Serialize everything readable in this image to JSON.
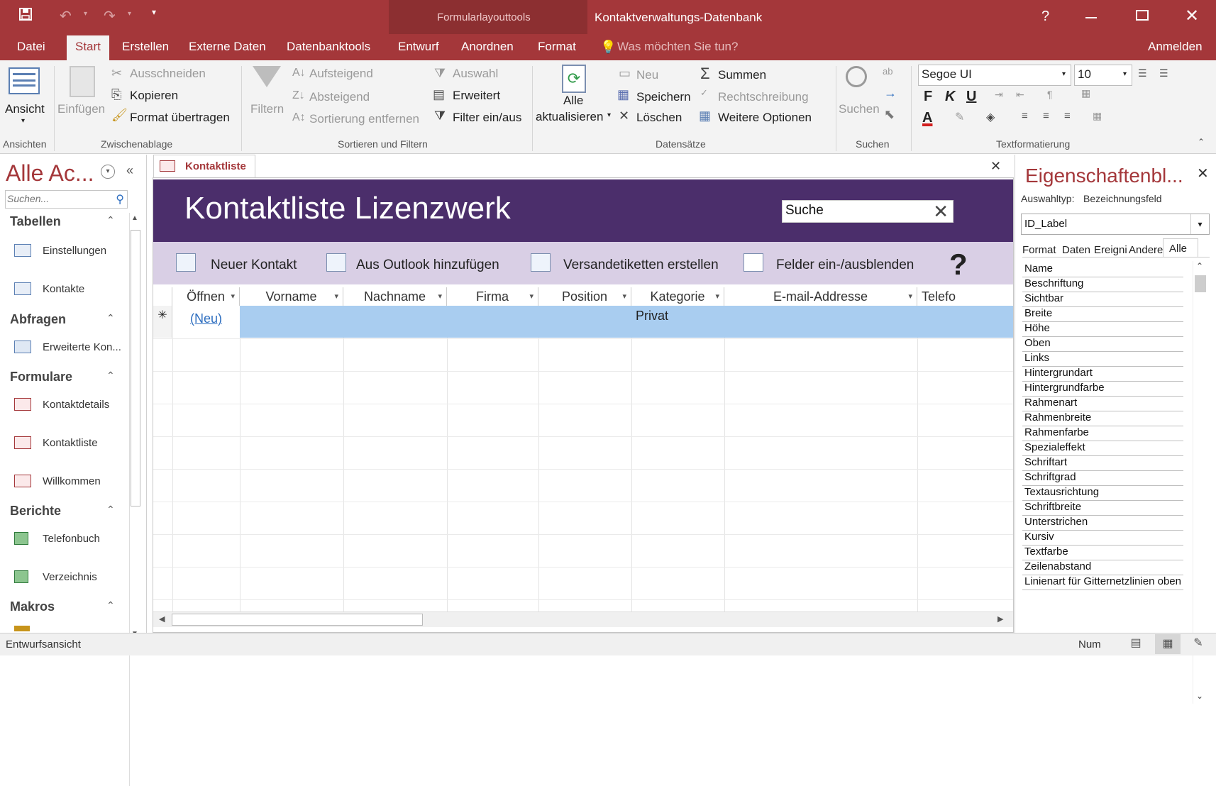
{
  "title_bar": {
    "context_tool": "Formularlayouttools",
    "app_title": "Kontaktverwaltungs-Datenbank",
    "help": "?"
  },
  "tabs": [
    "Datei",
    "Start",
    "Erstellen",
    "Externe Daten",
    "Datenbanktools",
    "Entwurf",
    "Anordnen",
    "Format"
  ],
  "tell_me": "Was möchten Sie tun?",
  "sign_in": "Anmelden",
  "ribbon": {
    "ansicht": "Ansicht",
    "einfuegen": "Einfügen",
    "ausschneiden": "Ausschneiden",
    "kopieren": "Kopieren",
    "format_uebertragen": "Format übertragen",
    "filtern": "Filtern",
    "aufsteigend": "Aufsteigend",
    "absteigend": "Absteigend",
    "sortierung_entfernen": "Sortierung entfernen",
    "auswahl": "Auswahl",
    "erweitert": "Erweitert",
    "filter_ein_aus": "Filter ein/aus",
    "alle": "Alle",
    "aktualisieren": "aktualisieren",
    "neu": "Neu",
    "speichern": "Speichern",
    "loeschen": "Löschen",
    "summen": "Summen",
    "rechtschreibung": "Rechtschreibung",
    "weitere_optionen": "Weitere Optionen",
    "suchen": "Suchen",
    "font_name": "Segoe UI",
    "font_size": "10",
    "bold": "F",
    "italic": "K",
    "underline": "U",
    "groups": {
      "ansichten": "Ansichten",
      "zwischenablage": "Zwischenablage",
      "sortieren": "Sortieren und Filtern",
      "datensaetze": "Datensätze",
      "suchen": "Suchen",
      "textformatierung": "Textformatierung"
    }
  },
  "nav": {
    "header": "Alle Ac...",
    "search_placeholder": "Suchen...",
    "sections": [
      {
        "title": "Tabellen",
        "items": [
          "Einstellungen",
          "Kontakte"
        ]
      },
      {
        "title": "Abfragen",
        "items": [
          "Erweiterte Kon..."
        ]
      },
      {
        "title": "Formulare",
        "items": [
          "Kontaktdetails",
          "Kontaktliste",
          "Willkommen"
        ]
      },
      {
        "title": "Berichte",
        "items": [
          "Telefonbuch",
          "Verzeichnis"
        ]
      },
      {
        "title": "Makros",
        "items": []
      }
    ]
  },
  "document": {
    "tab_label": "Kontaktliste",
    "form_title": "Kontaktliste Lizenzwerk",
    "search_value": "Suche",
    "commands": [
      "Neuer Kontakt",
      "Aus Outlook hinzufügen",
      "Versandetiketten erstellen",
      "Felder ein-/ausblenden"
    ],
    "help": "?",
    "columns": [
      "Öffnen",
      "Vorname",
      "Nachname",
      "Firma",
      "Position",
      "Kategorie",
      "E-mail-Addresse",
      "Telefo"
    ],
    "new_row": {
      "open_link": "(Neu)",
      "kategorie": "Privat",
      "marker": "✳"
    }
  },
  "props": {
    "title": "Eigenschaftenbl...",
    "selection_type_label": "Auswahltyp:",
    "selection_type_value": "Bezeichnungsfeld",
    "selected_object": "ID_Label",
    "tabs": [
      "Format",
      "Daten",
      "Ereigni",
      "Andere",
      "Alle"
    ],
    "active_tab": "Alle",
    "rows": [
      "Name",
      "Beschriftung",
      "Sichtbar",
      "Breite",
      "Höhe",
      "Oben",
      "Links",
      "Hintergrundart",
      "Hintergrundfarbe",
      "Rahmenart",
      "Rahmenbreite",
      "Rahmenfarbe",
      "Spezialeffekt",
      "Schriftart",
      "Schriftgrad",
      "Textausrichtung",
      "Schriftbreite",
      "Unterstrichen",
      "Kursiv",
      "Textfarbe",
      "Zeilenabstand",
      "Linienart für Gitternetzlinien oben"
    ]
  },
  "status": {
    "left": "Entwurfsansicht",
    "num": "Num"
  },
  "colors": {
    "accent": "#a4373a",
    "form_header": "#4b2e6b",
    "command_bar": "#d9cfe5",
    "selected_row": "#a9cdf0"
  }
}
